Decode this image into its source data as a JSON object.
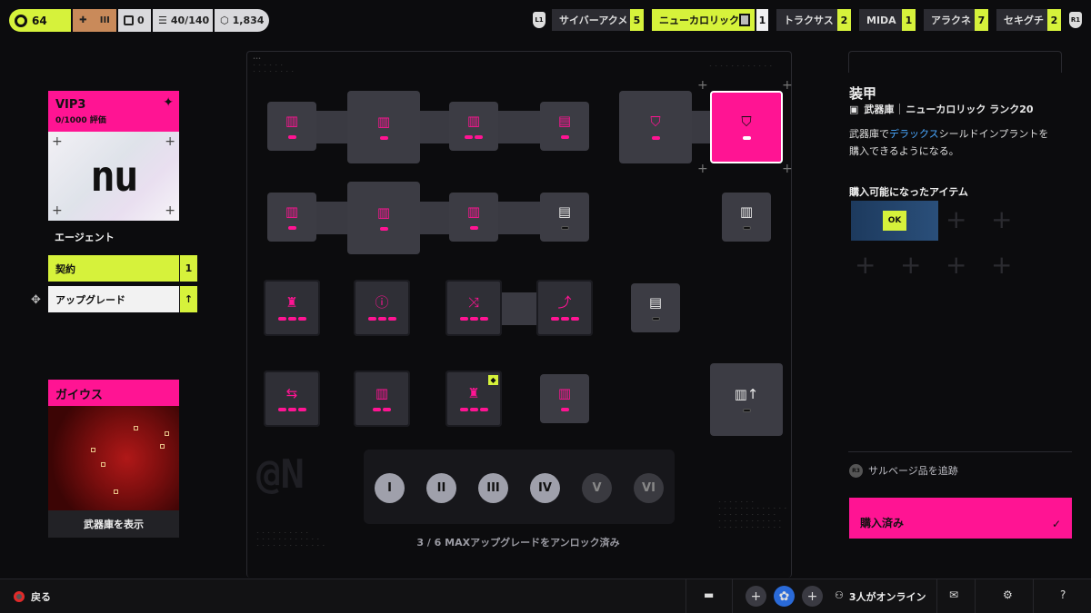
{
  "topbar": {
    "level": "64",
    "rank_numeral": "III",
    "stat_a": "0",
    "stat_b": "40/140",
    "stat_c": "1,834",
    "bumper_left": "L1",
    "bumper_right": "R1",
    "corps": [
      {
        "name": "サイバーアクメ",
        "count": "5"
      },
      {
        "name": "ニューカロリック",
        "count": "1"
      },
      {
        "name": "トラクサス",
        "count": "2"
      },
      {
        "name": "MIDA",
        "count": "1"
      },
      {
        "name": "アラクネ",
        "count": "7"
      },
      {
        "name": "セキグチ",
        "count": "2"
      }
    ]
  },
  "left": {
    "vip_title": "VIP3",
    "vip_sub": "0/1000 評価",
    "logo_text": "nu",
    "agent_label": "エージェント",
    "contract_label": "契約",
    "contract_value": "1",
    "upgrade_label": "アップグレード",
    "upgrade_arrow": "↑",
    "gaius_title": "ガイウス",
    "gaius_button": "武器庫を表示"
  },
  "grid": {
    "tiers": [
      "I",
      "II",
      "III",
      "IV",
      "V",
      "VI"
    ],
    "active_tiers": 4,
    "unlock_text": "3 / 6 MAXアップグレードをアンロック済み"
  },
  "right": {
    "title": "装甲",
    "source": "武器庫",
    "requirement": "ニューカロリック ランク20",
    "desc_before": "武器庫で",
    "desc_highlight": "デラックス",
    "desc_after": "シールドインプラントを購入できるようになる。",
    "available_label": "購入可能になったアイテム",
    "item_icon_label": "OK",
    "r3_label": "R3",
    "track_label": "サルベージ品を追跡",
    "purchased_label": "購入済み",
    "purchased_mark": "✓"
  },
  "bottom": {
    "back_label": "戻る",
    "online_text": "3人がオンライン",
    "help": "?"
  },
  "colors": {
    "accent_pink": "#ff1493",
    "accent_lime": "#d6f23b",
    "panel": "#3c3c44"
  }
}
